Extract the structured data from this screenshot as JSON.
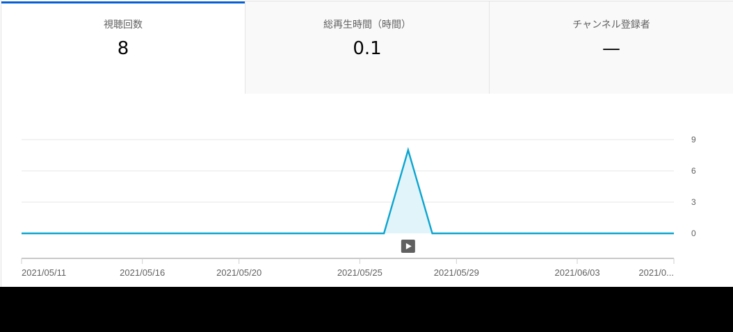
{
  "tabs": [
    {
      "label": "視聴回数",
      "value": "8"
    },
    {
      "label": "総再生時間（時間）",
      "value": "0.1"
    },
    {
      "label": "チャンネル登録者",
      "value": "—"
    }
  ],
  "chart_data": {
    "type": "area",
    "x": [
      "2021/05/11",
      "2021/05/12",
      "2021/05/13",
      "2021/05/14",
      "2021/05/15",
      "2021/05/16",
      "2021/05/17",
      "2021/05/18",
      "2021/05/19",
      "2021/05/20",
      "2021/05/21",
      "2021/05/22",
      "2021/05/23",
      "2021/05/24",
      "2021/05/25",
      "2021/05/26",
      "2021/05/27",
      "2021/05/28",
      "2021/05/29",
      "2021/05/30",
      "2021/05/31",
      "2021/06/01",
      "2021/06/02",
      "2021/06/03",
      "2021/06/04",
      "2021/06/05",
      "2021/06/06",
      "2021/06/07"
    ],
    "series": [
      {
        "values": [
          0,
          0,
          0,
          0,
          0,
          0,
          0,
          0,
          0,
          0,
          0,
          0,
          0,
          0,
          0,
          0,
          8,
          0,
          0,
          0,
          0,
          0,
          0,
          0,
          0,
          0,
          0,
          0
        ]
      }
    ],
    "ylim": [
      0,
      9
    ],
    "yticks": [
      {
        "value": 9,
        "label": "9"
      },
      {
        "value": 6,
        "label": "6"
      },
      {
        "value": 3,
        "label": "3"
      },
      {
        "value": 0,
        "label": "0"
      }
    ],
    "xticks": [
      {
        "date": "2021/05/11",
        "label": "2021/05/11"
      },
      {
        "date": "2021/05/16",
        "label": "2021/05/16"
      },
      {
        "date": "2021/05/20",
        "label": "2021/05/20"
      },
      {
        "date": "2021/05/25",
        "label": "2021/05/25"
      },
      {
        "date": "2021/05/29",
        "label": "2021/05/29"
      },
      {
        "date": "2021/06/03",
        "label": "2021/06/03"
      },
      {
        "date": "2021/06/07",
        "label": "2021/0..."
      }
    ],
    "grid": true,
    "colors": {
      "line": "#0ba5cf",
      "fill": "#e1f4fa",
      "grid": "#e5e5e5",
      "axis": "#909090"
    },
    "marker": {
      "date": "2021/05/27",
      "icon": "play-icon"
    }
  }
}
